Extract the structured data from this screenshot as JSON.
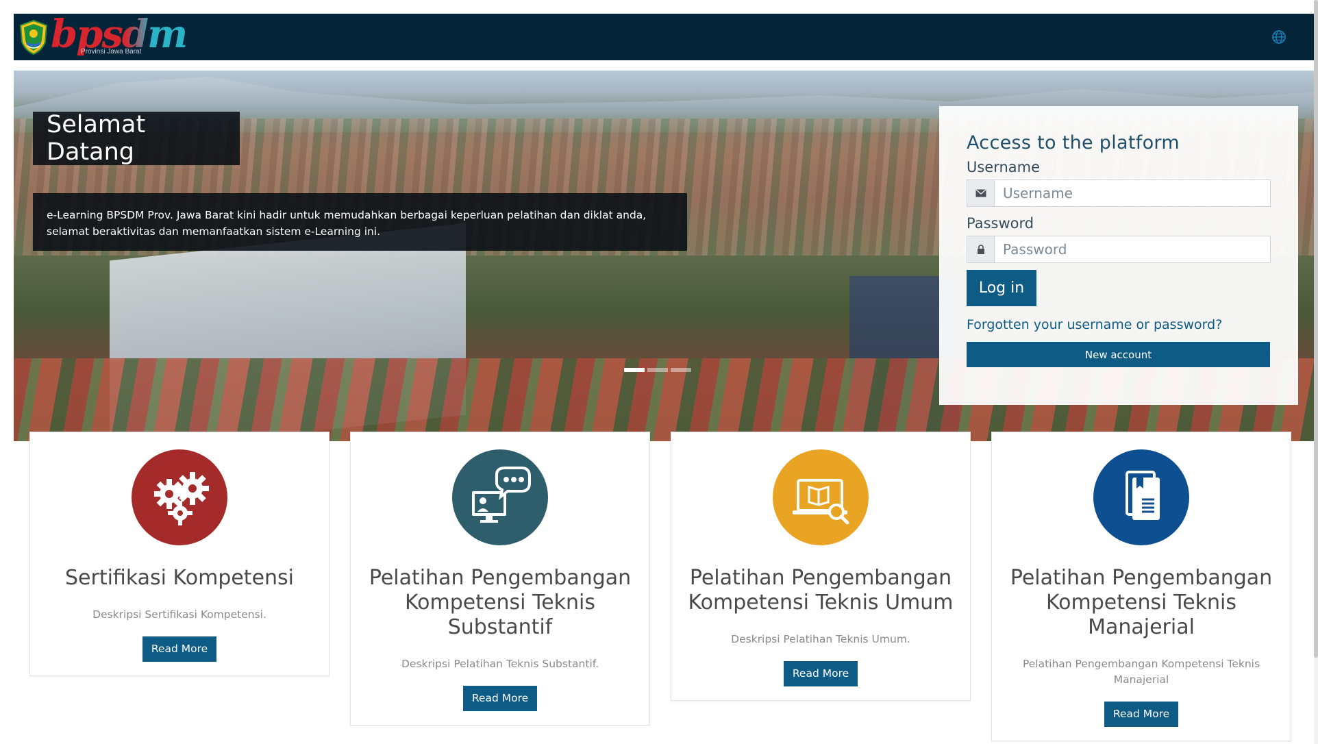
{
  "brand": {
    "logo_text": "bpsdm",
    "logo_subtitle": "Provinsi Jawa Barat"
  },
  "navbar": {
    "globe_icon": "globe-icon",
    "bg_color": "#04243a"
  },
  "hero": {
    "title": "Selamat Datang",
    "description": "e-Learning BPSDM Prov. Jawa Barat kini hadir untuk memudahkan berbagai keperluan pelatihan dan diklat anda, selamat beraktivitas dan memanfaatkan sistem e-Learning ini.",
    "slide_count": 3,
    "active_slide": 1
  },
  "login": {
    "title": "Access to the platform",
    "username_label": "Username",
    "username_placeholder": "Username",
    "password_label": "Password",
    "password_placeholder": "Password",
    "login_button": "Log in",
    "forgot_link": "Forgotten your username or password?",
    "new_account_button": "New account",
    "accent_color": "#0e5b85"
  },
  "cards": [
    {
      "title": "Sertifikasi Kompetensi",
      "description": "Deskripsi Sertifikasi Kompetensi.",
      "button": "Read More",
      "icon": "gears-icon",
      "icon_color": "#a52a2a"
    },
    {
      "title": "Pelatihan Pengembangan Kompetensi Teknis Substantif",
      "description": "Deskripsi Pelatihan Teknis Substantif.",
      "button": "Read More",
      "icon": "online-training-icon",
      "icon_color": "#2e5d6b"
    },
    {
      "title": "Pelatihan Pengembangan Kompetensi Teknis Umum",
      "description": "Deskripsi Pelatihan Teknis Umum.",
      "button": "Read More",
      "icon": "ebook-search-icon",
      "icon_color": "#e9a424"
    },
    {
      "title": "Pelatihan Pengembangan Kompetensi Teknis Manajerial",
      "description": "Pelatihan Pengembangan Kompetensi Teknis Manajerial",
      "button": "Read More",
      "icon": "document-icon",
      "icon_color": "#0d4f91"
    }
  ]
}
